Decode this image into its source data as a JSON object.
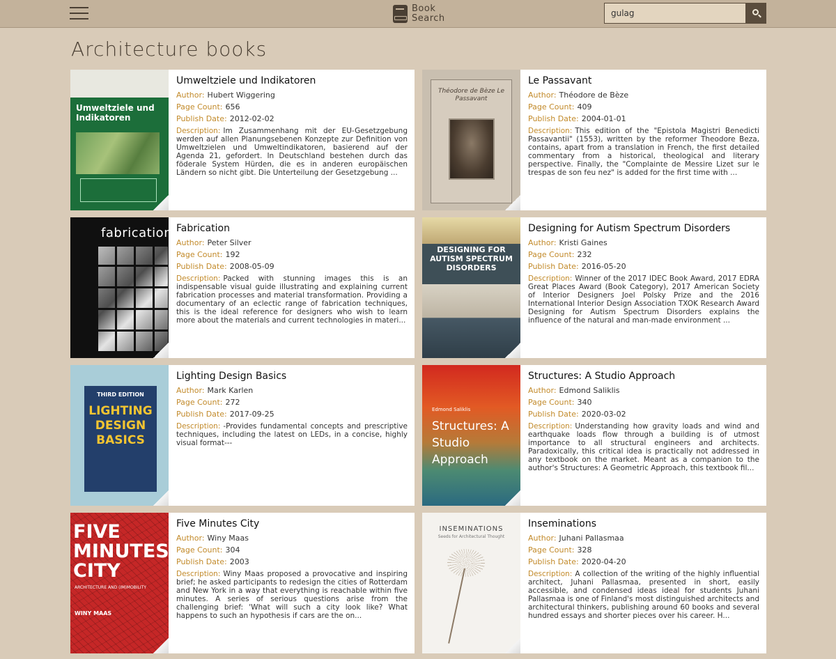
{
  "header": {
    "brand_line1": "Book",
    "brand_line2": "Search",
    "search_value": "gulag",
    "search_placeholder": ""
  },
  "page_title": "Architecture books",
  "labels": {
    "author": "Author:",
    "page_count": "Page Count:",
    "publish_date": "Publish Date:",
    "description": "Description:"
  },
  "books": [
    {
      "title": "Umweltziele und Indikatoren",
      "author": "Hubert Wiggering",
      "page_count": "656",
      "publish_date": "2012-02-02",
      "description": "Im Zusammenhang mit der EU-Gesetzgebung werden auf allen Planungsebenen Konzepte zur Definition von Umweltzielen und Umweltindikatoren, basierend auf der Agenda 21, gefordert. In Deutschland bestehen durch das föderale System Hürden, die es in anderen europäischen Ländern so nicht gibt. Die Unterteilung der Gesetzgebung ...",
      "cover_text": "Umweltziele und Indikatoren"
    },
    {
      "title": "Le Passavant",
      "author": "Théodore de Bèze",
      "page_count": "409",
      "publish_date": "2004-01-01",
      "description": "This edition of the \"Epistola Magistri Benedicti Passavantii\" (1553), written by the reformer Theodore Beza, contains, apart from a translation in French, the first detailed commentary from a historical, theological and literary perspective. Finally, the \"Complainte de Messire Lizet sur le trespas de son feu nez\" is added for the first time with ...",
      "cover_text": "Théodore de Bèze Le Passavant"
    },
    {
      "title": "Fabrication",
      "author": "Peter Silver",
      "page_count": "192",
      "publish_date": "2008-05-09",
      "description": "Packed with stunning images this is an indispensable visual guide illustrating and explaining current fabrication processes and material transformation. Providing a documentary of an eclectic range of fabrication techniques, this is the ideal reference for designers who wish to learn more about the materials and current technologies in materi...",
      "cover_text": "fabrication"
    },
    {
      "title": "Designing for Autism Spectrum Disorders",
      "author": "Kristi Gaines",
      "page_count": "232",
      "publish_date": "2016-05-20",
      "description": "Winner of the 2017 IDEC Book Award, 2017 EDRA Great Places Award (Book Category), 2017 American Society of Interior Designers Joel Polsky Prize and the 2016 International Interior Design Association TXOK Research Award Designing for Autism Spectrum Disorders explains the influence of the natural and man-made environment ...",
      "cover_text": "DESIGNING FOR AUTISM SPECTRUM DISORDERS"
    },
    {
      "title": "Lighting Design Basics",
      "author": "Mark Karlen",
      "page_count": "272",
      "publish_date": "2017-09-25",
      "description": "-Provides fundamental concepts and prescriptive techniques, including the latest on LEDs, in a concise, highly visual format---",
      "cover_edition": "THIRD EDITION",
      "cover_text": "LIGHTING DESIGN BASICS"
    },
    {
      "title": "Structures: A Studio Approach",
      "author": "Edmond Saliklis",
      "page_count": "340",
      "publish_date": "2020-03-02",
      "description": "Understanding how gravity loads and wind and earthquake loads flow through a building is of utmost importance to all structural engineers and architects. Paradoxically, this critical idea is practically not addressed in any textbook on the market. Meant as a companion to the author's Structures: A Geometric Approach, this textbook fil...",
      "cover_author": "Edmond Saliklis",
      "cover_text": "Structures: A Studio Approach"
    },
    {
      "title": "Five Minutes City",
      "author": "Winy Maas",
      "page_count": "304",
      "publish_date": "2003",
      "description": "Winy Maas proposed a provocative and inspiring brief; he asked participants to redesign the cities of Rotterdam and New York in a way that everything is reachable within five minutes. A series of serious questions arise from the challenging brief: 'What will such a city look like? What happens to such an hypothesis if cars are the on...",
      "cover_text": "FIVE MINUTES CITY",
      "cover_sub": "ARCHITECTURE AND (IM)MOBILITY",
      "cover_author": "WINY MAAS"
    },
    {
      "title": "Inseminations",
      "author": "Juhani Pallasmaa",
      "page_count": "328",
      "publish_date": "2020-04-20",
      "description": "A collection of the writing of the highly influential architect, Juhani Pallasmaa, presented in short, easily accessible, and condensed ideas ideal for students Juhani Pallasmaa is one of Finland's most distinguished architects and architectural thinkers, publishing around 60 books and several hundred essays and shorter pieces over his career. H...",
      "cover_text": "INSEMINATIONS",
      "cover_sub": "Seeds for Architectural Thought"
    }
  ]
}
